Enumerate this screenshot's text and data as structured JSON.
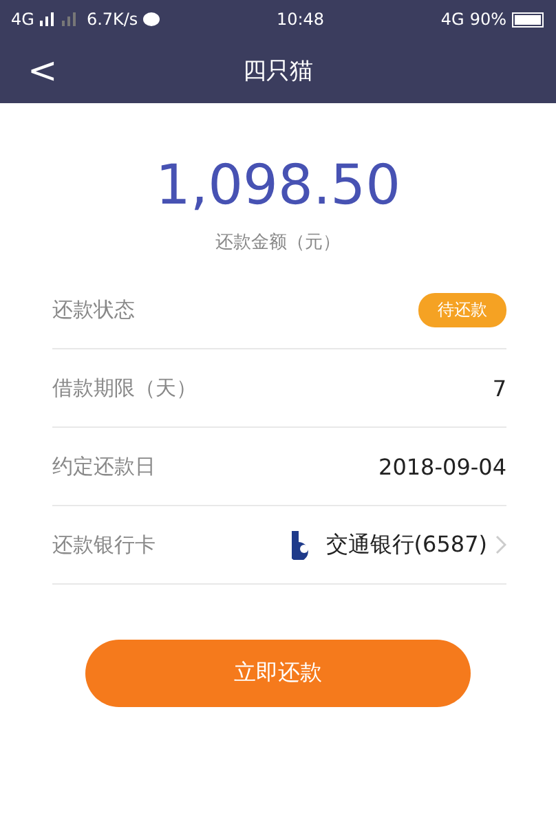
{
  "status_bar": {
    "left": "4G",
    "speed": "6.7K/s",
    "time": "10:48",
    "network": "4G",
    "battery": "90%"
  },
  "nav": {
    "back": "<",
    "title": "四只猫"
  },
  "amount": {
    "value": "1,098.50",
    "label": "还款金额（元）"
  },
  "rows": [
    {
      "kind": "badge",
      "label": "还款状态",
      "value": "待还款"
    },
    {
      "kind": "text",
      "label": "借款期限（天）",
      "value": "7"
    },
    {
      "kind": "text",
      "label": "约定还款日",
      "value": "2018-09-04"
    },
    {
      "kind": "bank",
      "label": "还款银行卡",
      "value": "交通银行(6587)"
    }
  ],
  "button": "立即还款"
}
